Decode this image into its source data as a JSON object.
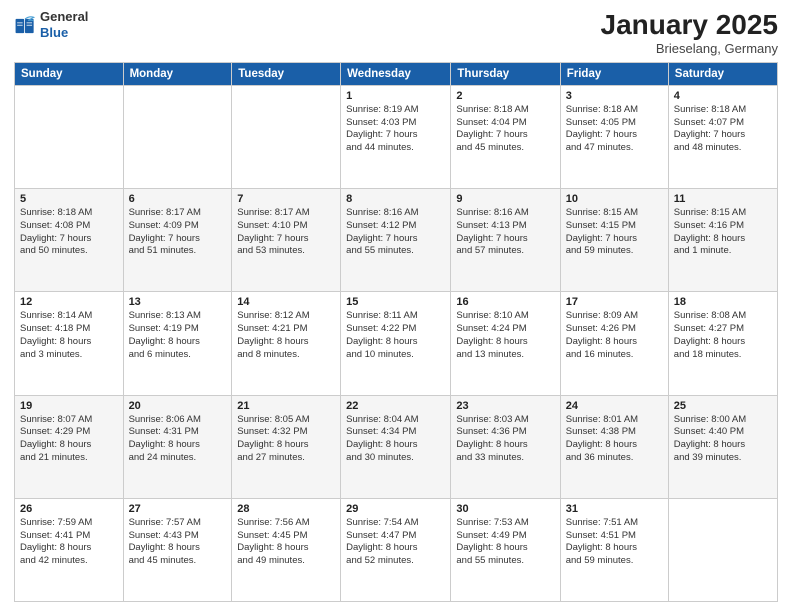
{
  "logo": {
    "general": "General",
    "blue": "Blue"
  },
  "header": {
    "month": "January 2025",
    "location": "Brieselang, Germany"
  },
  "weekdays": [
    "Sunday",
    "Monday",
    "Tuesday",
    "Wednesday",
    "Thursday",
    "Friday",
    "Saturday"
  ],
  "weeks": [
    [
      {
        "day": "",
        "content": ""
      },
      {
        "day": "",
        "content": ""
      },
      {
        "day": "",
        "content": ""
      },
      {
        "day": "1",
        "content": "Sunrise: 8:19 AM\nSunset: 4:03 PM\nDaylight: 7 hours\nand 44 minutes."
      },
      {
        "day": "2",
        "content": "Sunrise: 8:18 AM\nSunset: 4:04 PM\nDaylight: 7 hours\nand 45 minutes."
      },
      {
        "day": "3",
        "content": "Sunrise: 8:18 AM\nSunset: 4:05 PM\nDaylight: 7 hours\nand 47 minutes."
      },
      {
        "day": "4",
        "content": "Sunrise: 8:18 AM\nSunset: 4:07 PM\nDaylight: 7 hours\nand 48 minutes."
      }
    ],
    [
      {
        "day": "5",
        "content": "Sunrise: 8:18 AM\nSunset: 4:08 PM\nDaylight: 7 hours\nand 50 minutes."
      },
      {
        "day": "6",
        "content": "Sunrise: 8:17 AM\nSunset: 4:09 PM\nDaylight: 7 hours\nand 51 minutes."
      },
      {
        "day": "7",
        "content": "Sunrise: 8:17 AM\nSunset: 4:10 PM\nDaylight: 7 hours\nand 53 minutes."
      },
      {
        "day": "8",
        "content": "Sunrise: 8:16 AM\nSunset: 4:12 PM\nDaylight: 7 hours\nand 55 minutes."
      },
      {
        "day": "9",
        "content": "Sunrise: 8:16 AM\nSunset: 4:13 PM\nDaylight: 7 hours\nand 57 minutes."
      },
      {
        "day": "10",
        "content": "Sunrise: 8:15 AM\nSunset: 4:15 PM\nDaylight: 7 hours\nand 59 minutes."
      },
      {
        "day": "11",
        "content": "Sunrise: 8:15 AM\nSunset: 4:16 PM\nDaylight: 8 hours\nand 1 minute."
      }
    ],
    [
      {
        "day": "12",
        "content": "Sunrise: 8:14 AM\nSunset: 4:18 PM\nDaylight: 8 hours\nand 3 minutes."
      },
      {
        "day": "13",
        "content": "Sunrise: 8:13 AM\nSunset: 4:19 PM\nDaylight: 8 hours\nand 6 minutes."
      },
      {
        "day": "14",
        "content": "Sunrise: 8:12 AM\nSunset: 4:21 PM\nDaylight: 8 hours\nand 8 minutes."
      },
      {
        "day": "15",
        "content": "Sunrise: 8:11 AM\nSunset: 4:22 PM\nDaylight: 8 hours\nand 10 minutes."
      },
      {
        "day": "16",
        "content": "Sunrise: 8:10 AM\nSunset: 4:24 PM\nDaylight: 8 hours\nand 13 minutes."
      },
      {
        "day": "17",
        "content": "Sunrise: 8:09 AM\nSunset: 4:26 PM\nDaylight: 8 hours\nand 16 minutes."
      },
      {
        "day": "18",
        "content": "Sunrise: 8:08 AM\nSunset: 4:27 PM\nDaylight: 8 hours\nand 18 minutes."
      }
    ],
    [
      {
        "day": "19",
        "content": "Sunrise: 8:07 AM\nSunset: 4:29 PM\nDaylight: 8 hours\nand 21 minutes."
      },
      {
        "day": "20",
        "content": "Sunrise: 8:06 AM\nSunset: 4:31 PM\nDaylight: 8 hours\nand 24 minutes."
      },
      {
        "day": "21",
        "content": "Sunrise: 8:05 AM\nSunset: 4:32 PM\nDaylight: 8 hours\nand 27 minutes."
      },
      {
        "day": "22",
        "content": "Sunrise: 8:04 AM\nSunset: 4:34 PM\nDaylight: 8 hours\nand 30 minutes."
      },
      {
        "day": "23",
        "content": "Sunrise: 8:03 AM\nSunset: 4:36 PM\nDaylight: 8 hours\nand 33 minutes."
      },
      {
        "day": "24",
        "content": "Sunrise: 8:01 AM\nSunset: 4:38 PM\nDaylight: 8 hours\nand 36 minutes."
      },
      {
        "day": "25",
        "content": "Sunrise: 8:00 AM\nSunset: 4:40 PM\nDaylight: 8 hours\nand 39 minutes."
      }
    ],
    [
      {
        "day": "26",
        "content": "Sunrise: 7:59 AM\nSunset: 4:41 PM\nDaylight: 8 hours\nand 42 minutes."
      },
      {
        "day": "27",
        "content": "Sunrise: 7:57 AM\nSunset: 4:43 PM\nDaylight: 8 hours\nand 45 minutes."
      },
      {
        "day": "28",
        "content": "Sunrise: 7:56 AM\nSunset: 4:45 PM\nDaylight: 8 hours\nand 49 minutes."
      },
      {
        "day": "29",
        "content": "Sunrise: 7:54 AM\nSunset: 4:47 PM\nDaylight: 8 hours\nand 52 minutes."
      },
      {
        "day": "30",
        "content": "Sunrise: 7:53 AM\nSunset: 4:49 PM\nDaylight: 8 hours\nand 55 minutes."
      },
      {
        "day": "31",
        "content": "Sunrise: 7:51 AM\nSunset: 4:51 PM\nDaylight: 8 hours\nand 59 minutes."
      },
      {
        "day": "",
        "content": ""
      }
    ]
  ]
}
